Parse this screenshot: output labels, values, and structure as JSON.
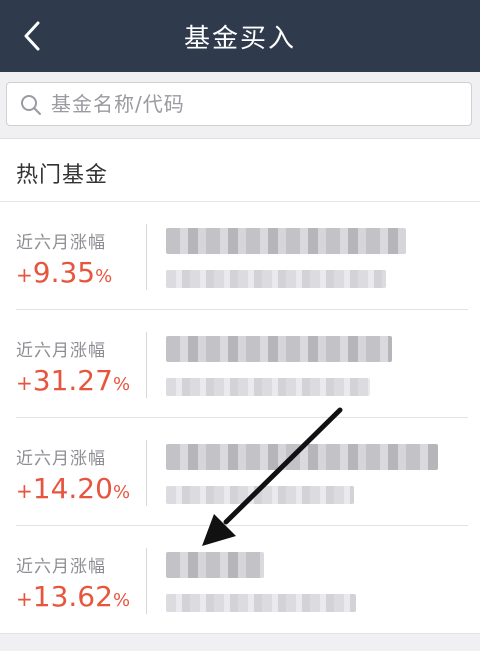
{
  "header": {
    "title": "基金买入",
    "back_icon": "chevron-left-icon"
  },
  "search": {
    "placeholder": "基金名称/代码",
    "icon": "search-icon"
  },
  "section": {
    "title": "热门基金"
  },
  "funds": [
    {
      "gain_label": "近六月涨幅",
      "sign": "+",
      "value": "9.35",
      "unit": "%"
    },
    {
      "gain_label": "近六月涨幅",
      "sign": "+",
      "value": "31.27",
      "unit": "%"
    },
    {
      "gain_label": "近六月涨幅",
      "sign": "+",
      "value": "14.20",
      "unit": "%"
    },
    {
      "gain_label": "近六月涨幅",
      "sign": "+",
      "value": "13.62",
      "unit": "%"
    }
  ],
  "colors": {
    "header_bg": "#2f3b4d",
    "gain": "#e8553e",
    "page_bg": "#f0f0f2"
  }
}
